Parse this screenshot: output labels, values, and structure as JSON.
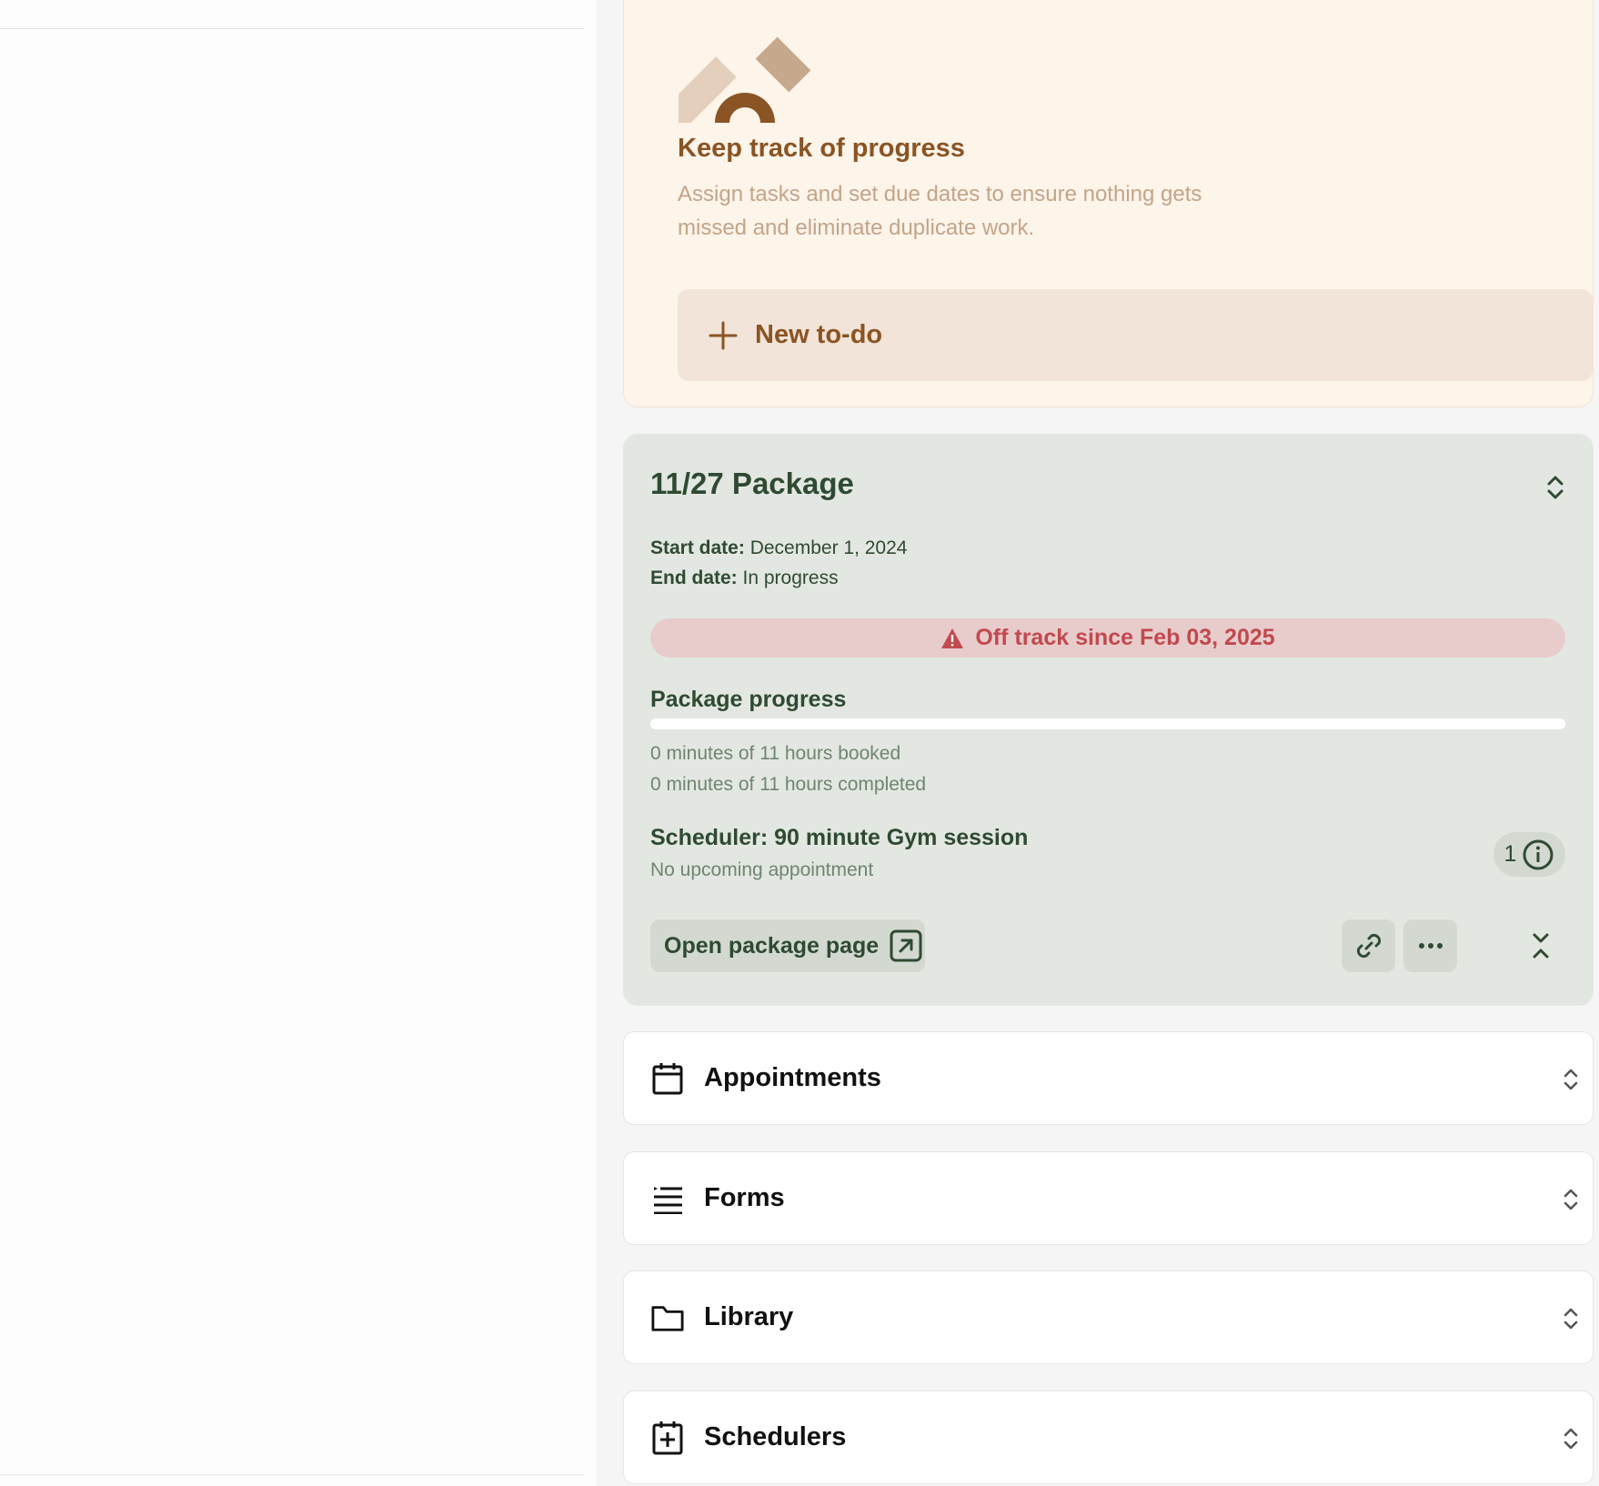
{
  "promo": {
    "title": "Keep track of progress",
    "description": "Assign tasks and set due dates to ensure nothing gets missed and eliminate duplicate work.",
    "new_todo_label": "New to-do",
    "colors": {
      "background": "#fdf4ea",
      "accent": "#8a5424",
      "muted": "#c4a488"
    }
  },
  "package": {
    "title": "11/27 Package",
    "start_date_label": "Start date:",
    "start_date_value": "December 1, 2024",
    "end_date_label": "End date:",
    "end_date_value": "In progress",
    "status_text": "Off track since Feb 03, 2025",
    "progress_label": "Package progress",
    "progress_fraction": 0,
    "booked_text": "0 minutes of 11 hours booked",
    "completed_text": "0 minutes of 11 hours completed",
    "scheduler_title": "Scheduler: 90 minute Gym session",
    "scheduler_sub": "No upcoming appointment",
    "info_count": "1",
    "open_button_label": "Open package page",
    "colors": {
      "background": "#e3e7e1",
      "text": "#2f4a32",
      "warning_bg": "#e8cccc",
      "warning_text": "#c2494e"
    }
  },
  "sections": [
    {
      "label": "Appointments",
      "icon": "calendar-icon"
    },
    {
      "label": "Forms",
      "icon": "list-icon"
    },
    {
      "label": "Library",
      "icon": "folder-icon"
    },
    {
      "label": "Schedulers",
      "icon": "calendar-plus-icon"
    }
  ]
}
